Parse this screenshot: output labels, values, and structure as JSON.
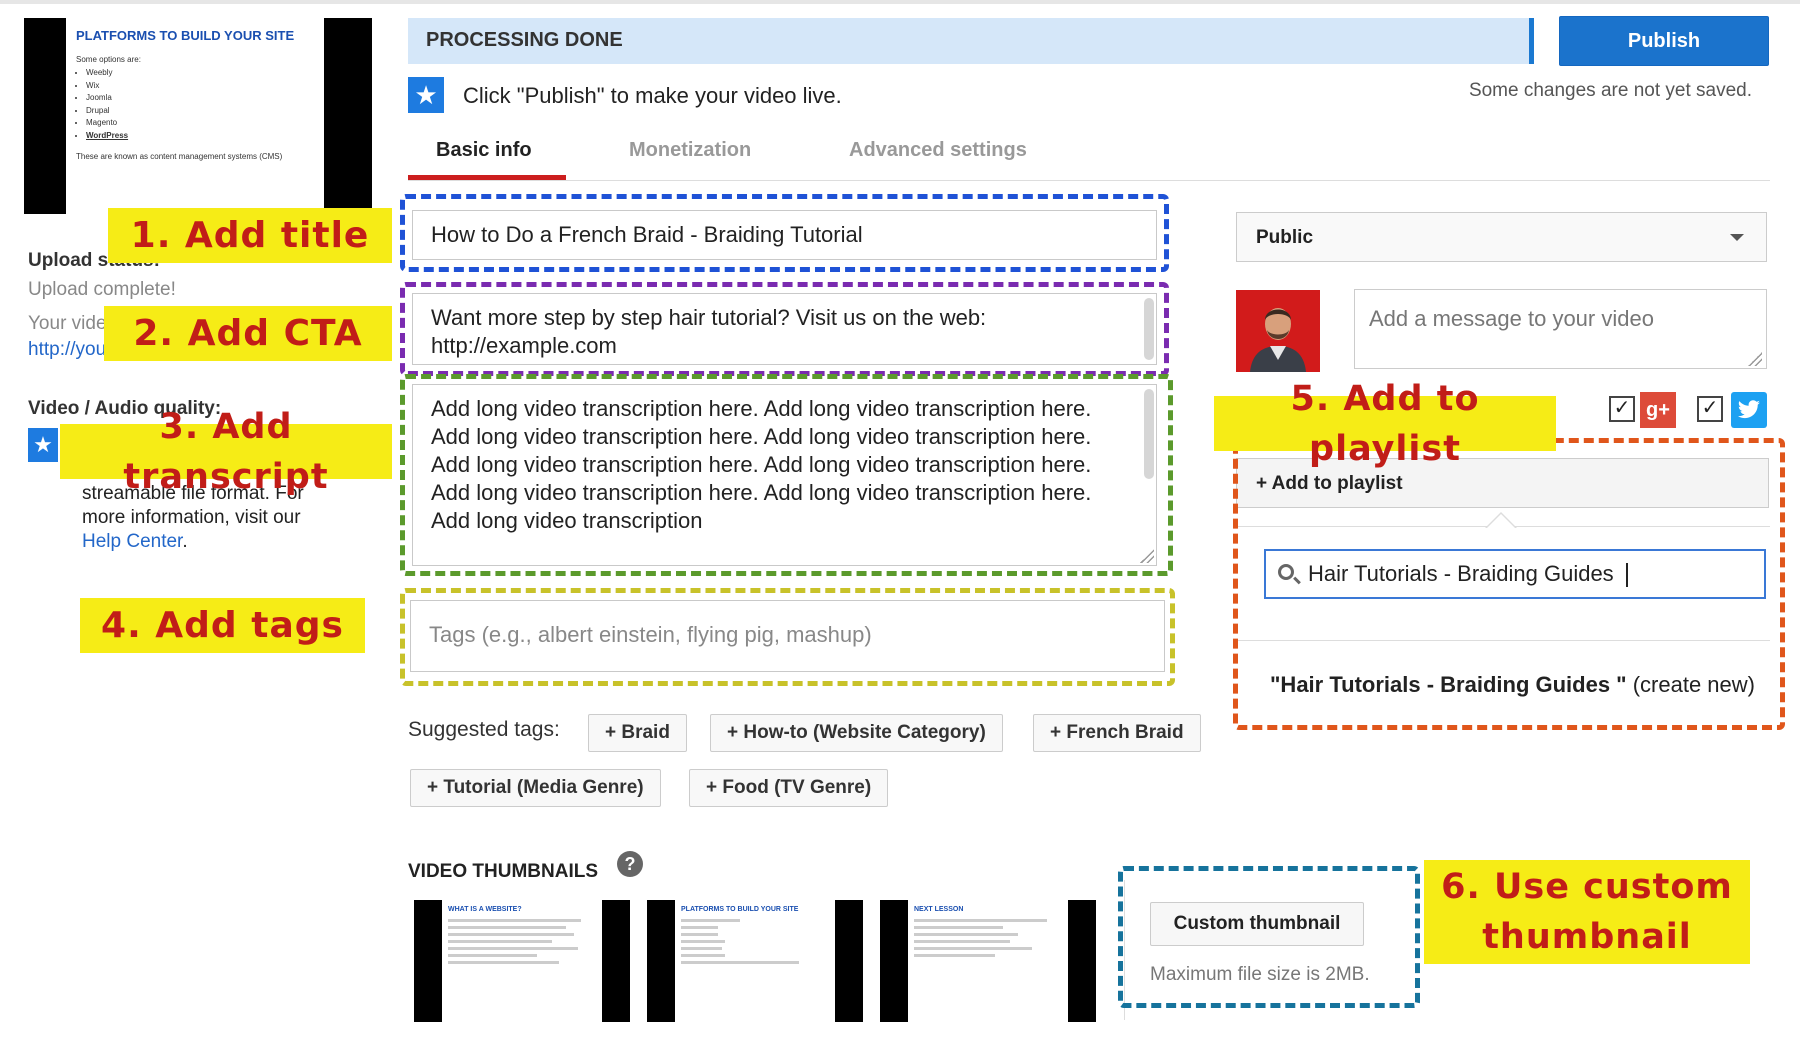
{
  "banner": {
    "status": "PROCESSING DONE",
    "publish_label": "Publish"
  },
  "notice": {
    "hint": "Click \"Publish\" to make your video live.",
    "unsaved": "Some changes are not yet saved."
  },
  "tabs": [
    {
      "label": "Basic info",
      "active": true
    },
    {
      "label": "Monetization",
      "active": false
    },
    {
      "label": "Advanced settings",
      "active": false
    }
  ],
  "preview": {
    "slide_title": "PLATFORMS TO BUILD YOUR SITE",
    "slide_sub": "Some options are:",
    "items": [
      "Weebly",
      "Wix",
      "Joomla",
      "Drupal",
      "Magento",
      "WordPress"
    ],
    "note": "These are known as content management systems (CMS)"
  },
  "sidebar": {
    "upload_status_label": "Upload status:",
    "upload_status_value": "Upload complete!",
    "your_video_text": "Your vide",
    "link_text": "http://you",
    "quality_label": "Video / Audio quality:",
    "quality_text_1": "streamable file format. For",
    "quality_text_2": "more information, visit our",
    "help_link": "Help Center",
    "period": "."
  },
  "form": {
    "title_value": "How to Do a French Braid - Braiding Tutorial",
    "description_value": "Want more step by step hair tutorial? Visit us on the web: http://example.com",
    "transcript_value": "Add long video transcription here. Add long video transcription here. Add long video transcription here. Add long video transcription here. Add long video transcription here. Add long video transcription here. Add long video transcription here. Add long video transcription here. Add long video transcription",
    "tags_placeholder": "Tags (e.g., albert einstein, flying pig, mashup)"
  },
  "suggested": {
    "label": "Suggested tags:",
    "tags": [
      "+ Braid",
      "+ How-to (Website Category)",
      "+ French Braid",
      "+ Tutorial (Media Genre)",
      "+ Food (TV Genre)"
    ]
  },
  "thumbnails": {
    "heading": "VIDEO THUMBNAILS",
    "help_glyph": "?",
    "items": [
      {
        "title": "WHAT IS A WEBSITE?"
      },
      {
        "title": "PLATFORMS TO BUILD YOUR SITE"
      },
      {
        "title": "NEXT LESSON"
      }
    ],
    "custom_label": "Custom thumbnail",
    "max_size": "Maximum file size is 2MB."
  },
  "right": {
    "privacy": "Public",
    "message_placeholder": "Add a message to your video",
    "gplus_glyph": "g+",
    "twitter_icon": "twitter-icon",
    "check_glyph": "✓",
    "playlist_button": "+ Add to playlist",
    "playlist_search": "Hair Tutorials - Braiding Guides",
    "create_name": "\"Hair Tutorials - Braiding Guides \"",
    "create_suffix": " (create new)"
  },
  "callouts": {
    "c1": "1. Add title",
    "c2": "2. Add CTA",
    "c3": "3. Add transcript",
    "c4": "4. Add tags",
    "c5": "5. Add to playlist",
    "c6": "6. Use custom thumbnail"
  },
  "colors": {
    "callout_bg": "#f6ec16",
    "callout_text": "#c11d18",
    "outline_title": "#1f52d6",
    "outline_cta": "#7a2bb0",
    "outline_transcript": "#5b9a2c",
    "outline_tags": "#c8c22a",
    "outline_playlist": "#e0561b",
    "outline_thumbnail": "#16739c",
    "publish": "#1b73cc"
  }
}
